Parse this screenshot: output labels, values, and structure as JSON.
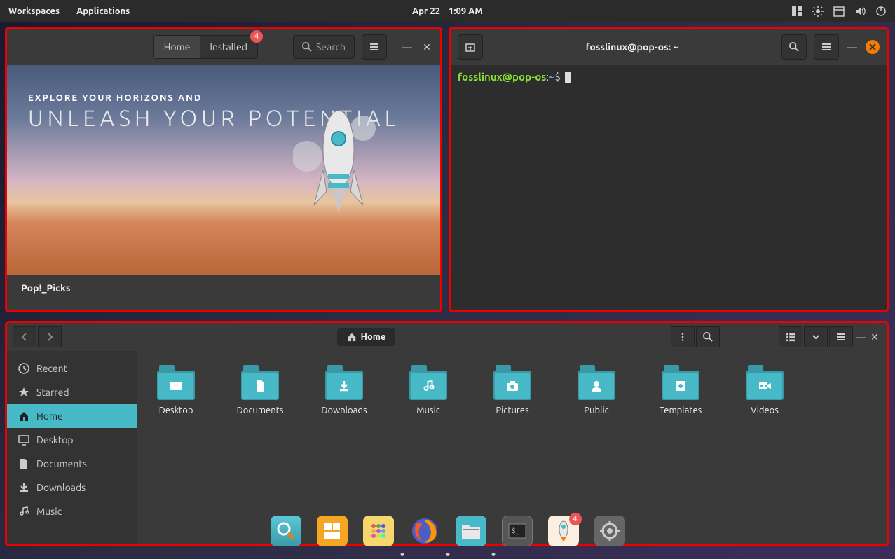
{
  "topbar": {
    "workspaces": "Workspaces",
    "applications": "Applications",
    "date": "Apr 22",
    "time": "1:09 AM"
  },
  "popshop": {
    "tabs": {
      "home": "Home",
      "installed": "Installed",
      "badge": "4"
    },
    "search": "Search",
    "hero_sub": "EXPLORE YOUR HORIZONS AND",
    "hero_title": "UNLEASH YOUR POTENTIAL",
    "picks": "Pop!_Picks"
  },
  "terminal": {
    "title": "fosslinux@pop-os: ~",
    "user": "fosslinux@pop-os",
    "colon": ":",
    "path": "~",
    "prompt": "$"
  },
  "files": {
    "path": "Home",
    "sidebar": [
      {
        "label": "Recent",
        "icon": "clock"
      },
      {
        "label": "Starred",
        "icon": "star"
      },
      {
        "label": "Home",
        "icon": "home",
        "active": true
      },
      {
        "label": "Desktop",
        "icon": "desktop"
      },
      {
        "label": "Documents",
        "icon": "doc"
      },
      {
        "label": "Downloads",
        "icon": "download"
      },
      {
        "label": "Music",
        "icon": "music"
      }
    ],
    "folders": [
      {
        "label": "Desktop",
        "sym": "window"
      },
      {
        "label": "Documents",
        "sym": "doc"
      },
      {
        "label": "Downloads",
        "sym": "download"
      },
      {
        "label": "Music",
        "sym": "music"
      },
      {
        "label": "Pictures",
        "sym": "camera"
      },
      {
        "label": "Public",
        "sym": "person"
      },
      {
        "label": "Templates",
        "sym": "template"
      },
      {
        "label": "Videos",
        "sym": "video"
      }
    ]
  },
  "dock": {
    "badge": "4"
  }
}
